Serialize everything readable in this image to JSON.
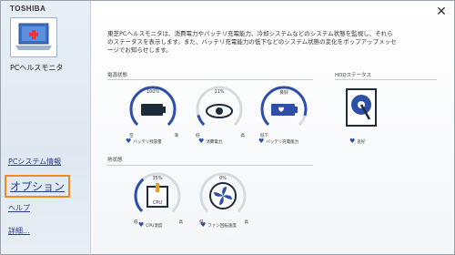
{
  "sidebar": {
    "brand": "TOSHIBA",
    "app_name": "PCヘルスモニタ",
    "items": [
      {
        "label": "PCシステム情報"
      },
      {
        "label": "オプション"
      },
      {
        "label": "ヘルプ"
      },
      {
        "label": "詳細..."
      }
    ]
  },
  "main": {
    "close_glyph": "✕",
    "description": "東芝PCヘルスモニタは、消費電力やバッテリ充電能力、冷却システムなどのシステム状態を監視し、それらのステータスを表示します。また、バッテリ充電能力の低下などのシステム状態の変化をポップアップメッセージでお知らせします。",
    "power_section": "電源状態",
    "hdd_section": "HDDステータス",
    "thermal_section": "熱状態",
    "gauges": {
      "battery_level": {
        "pct_text": "100%",
        "lo": "空",
        "hi": "満",
        "label": "バッテリ残容量",
        "fraction": 1.0
      },
      "power_consumption": {
        "pct_text": "11%",
        "lo": "低",
        "hi": "高",
        "label": "消費電力",
        "fraction": 0.11
      },
      "battery_capacity": {
        "pct_text": "良好",
        "lo": "低下",
        "hi": "",
        "label": "バッテリ充電能力",
        "fraction": 0.9
      },
      "cpu_temp": {
        "pct_text": "35%",
        "lo": "低",
        "hi": "高",
        "label": "CPU温度",
        "fraction": 0.35
      },
      "fan_speed": {
        "pct_text": "0%",
        "lo": "低",
        "hi": "高",
        "label": "ファン回転速度",
        "fraction": 0.0
      }
    },
    "hdd": {
      "label": "良好"
    },
    "cpu_icon_text": "CPU"
  },
  "colors": {
    "accent": "#2d4fa8",
    "highlight": "#f08c1d"
  }
}
